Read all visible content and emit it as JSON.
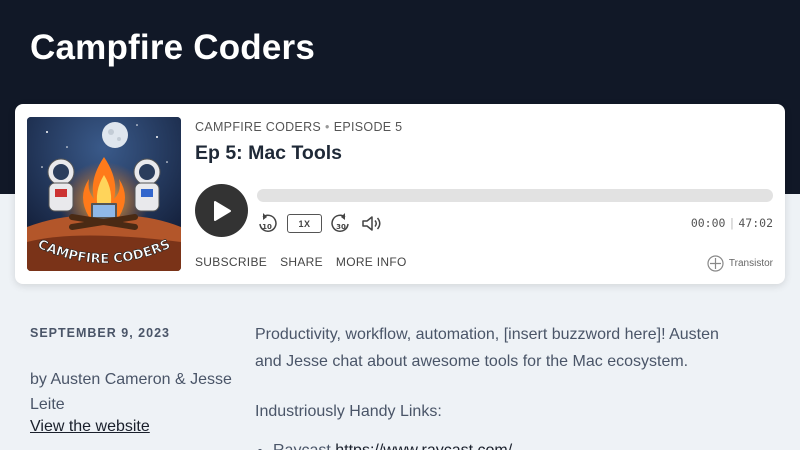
{
  "site": {
    "title": "Campfire Coders"
  },
  "player": {
    "show_name": "CAMPFIRE CODERS",
    "episode_label": "EPISODE 5",
    "episode_title": "Ep 5: Mac Tools",
    "artwork_text": "CAMPFIRE CODERS",
    "speed": "1X",
    "rewind_seconds": "10",
    "forward_seconds": "30",
    "current_time": "00:00",
    "duration": "47:02",
    "progress": 0,
    "actions": {
      "subscribe": "SUBSCRIBE",
      "share": "SHARE",
      "more_info": "MORE INFO"
    },
    "brand": "Transistor"
  },
  "episode": {
    "date": "SEPTEMBER 9, 2023",
    "byline": "by Austen Cameron & Jesse Leite",
    "website_link": "View the website",
    "description": "Productivity, workflow, automation, [insert buzzword here]! Austen and Jesse chat about awesome tools for the Mac ecosystem.",
    "links_heading": "Industriously Handy Links:",
    "links": [
      {
        "name": "Raycast",
        "url": "https://www.raycast.com/"
      }
    ]
  },
  "colors": {
    "header_bg": "#111827",
    "page_bg": "#eef2f6",
    "play_button": "#333333"
  }
}
